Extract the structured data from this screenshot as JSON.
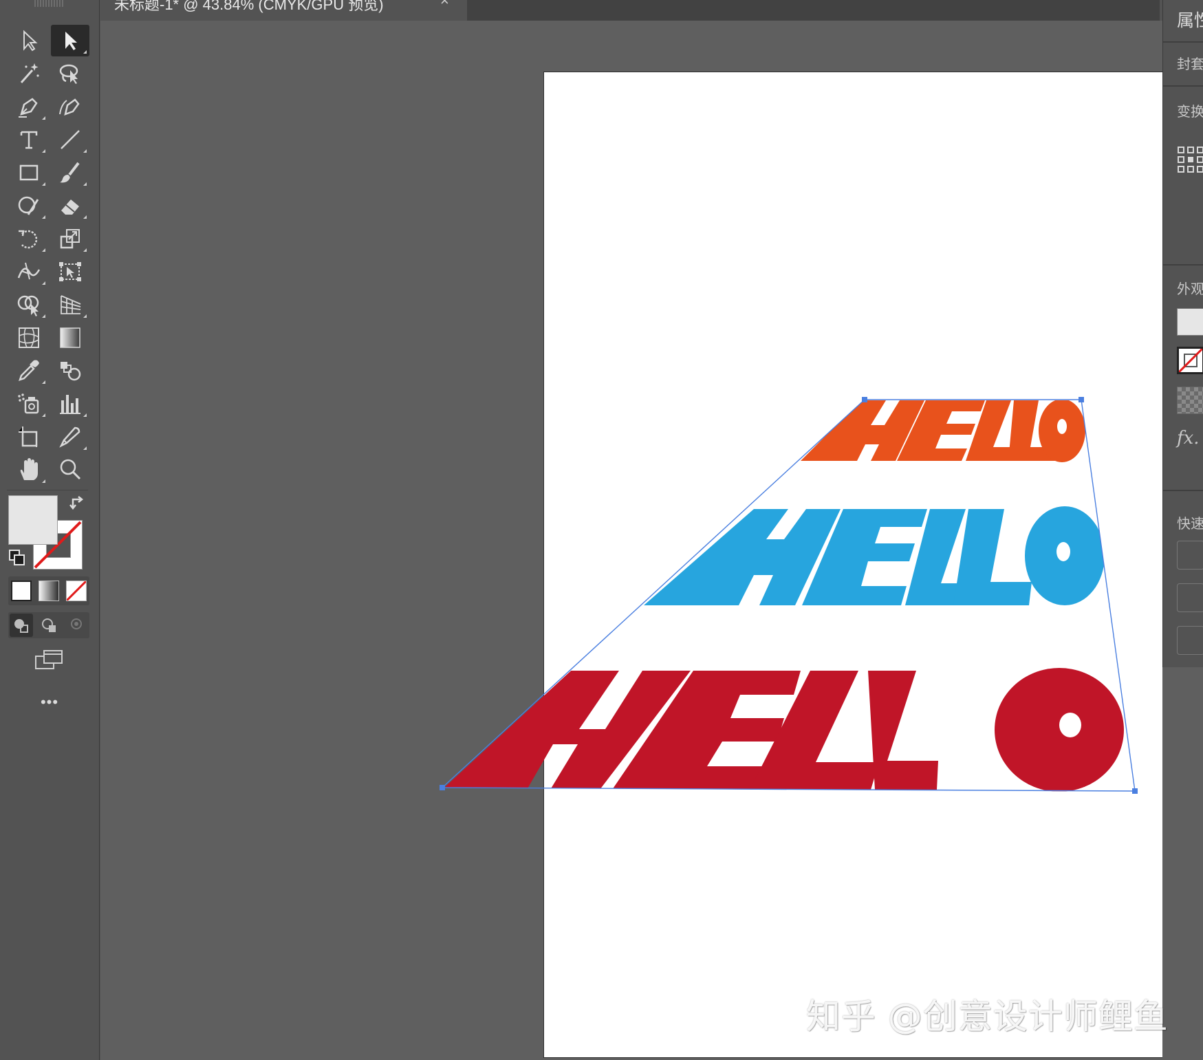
{
  "document_tab": {
    "title": "未标题-1* @ 43.84% (CMYK/GPU 预览)",
    "close": "×"
  },
  "toolbar": {
    "tools": [
      {
        "name": "selection-tool",
        "icon": "arrow-outline-icon",
        "active": false
      },
      {
        "name": "direct-selection-tool",
        "icon": "arrow-solid-icon",
        "active": true
      },
      {
        "name": "magic-wand-tool",
        "icon": "magic-wand-icon",
        "active": false
      },
      {
        "name": "lasso-tool",
        "icon": "lasso-icon",
        "active": false
      },
      {
        "name": "pen-tool",
        "icon": "pen-icon",
        "active": false
      },
      {
        "name": "curvature-tool",
        "icon": "curvature-pen-icon",
        "active": false
      },
      {
        "name": "type-tool",
        "icon": "type-icon",
        "active": false
      },
      {
        "name": "line-segment-tool",
        "icon": "line-icon",
        "active": false
      },
      {
        "name": "rectangle-tool",
        "icon": "rectangle-icon",
        "active": false
      },
      {
        "name": "paintbrush-tool",
        "icon": "brush-icon",
        "active": false
      },
      {
        "name": "shaper-tool",
        "icon": "shaper-icon",
        "active": false
      },
      {
        "name": "eraser-tool",
        "icon": "eraser-icon",
        "active": false
      },
      {
        "name": "rotate-tool",
        "icon": "rotate-icon",
        "active": false
      },
      {
        "name": "scale-tool",
        "icon": "scale-icon",
        "active": false
      },
      {
        "name": "width-tool",
        "icon": "width-icon",
        "active": false
      },
      {
        "name": "free-transform-tool",
        "icon": "free-transform-icon",
        "active": false
      },
      {
        "name": "shape-builder-tool",
        "icon": "shape-builder-icon",
        "active": false
      },
      {
        "name": "perspective-grid-tool",
        "icon": "perspective-grid-icon",
        "active": false
      },
      {
        "name": "mesh-tool",
        "icon": "mesh-icon",
        "active": false
      },
      {
        "name": "gradient-tool",
        "icon": "gradient-icon",
        "active": false
      },
      {
        "name": "eyedropper-tool",
        "icon": "eyedropper-icon",
        "active": false
      },
      {
        "name": "blend-tool",
        "icon": "blend-icon",
        "active": false
      },
      {
        "name": "symbol-sprayer-tool",
        "icon": "symbol-sprayer-icon",
        "active": false
      },
      {
        "name": "column-graph-tool",
        "icon": "column-graph-icon",
        "active": false
      },
      {
        "name": "artboard-tool",
        "icon": "artboard-icon",
        "active": false
      },
      {
        "name": "slice-tool",
        "icon": "slice-icon",
        "active": false
      },
      {
        "name": "hand-tool",
        "icon": "hand-icon",
        "active": false
      },
      {
        "name": "zoom-tool",
        "icon": "zoom-icon",
        "active": false
      }
    ],
    "more_label": "•••"
  },
  "artwork": {
    "rows": [
      {
        "text": "HELLO",
        "color": "#e8521c"
      },
      {
        "text": "HELLO",
        "color": "#27a5de"
      },
      {
        "text": "HELLO",
        "color": "#c01528"
      }
    ],
    "selection_color": "#4a7fe0"
  },
  "properties_panel": {
    "title": "属性",
    "envelope": "封套",
    "transform": "变换",
    "appearance": "外观",
    "fx": "fx.",
    "quick_actions": "快速"
  },
  "watermark": "知乎 @创意设计师鲤鱼"
}
